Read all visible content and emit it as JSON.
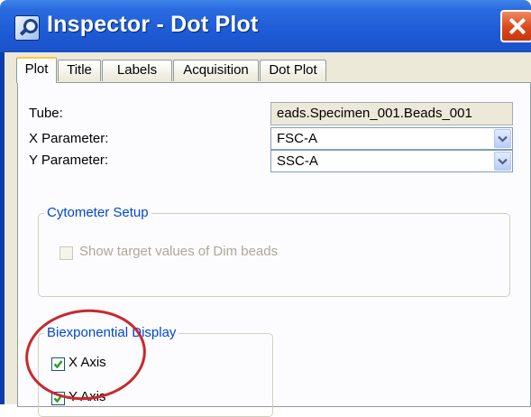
{
  "window": {
    "title": "Inspector - Dot Plot",
    "icon": "inspector-magnifier-icon",
    "close_icon": "close-icon"
  },
  "tabs": [
    {
      "label": "Plot",
      "active": true
    },
    {
      "label": "Title",
      "active": false
    },
    {
      "label": "Labels",
      "active": false
    },
    {
      "label": "Acquisition",
      "active": false
    },
    {
      "label": "Dot Plot",
      "active": false
    }
  ],
  "plot": {
    "tube_label": "Tube:",
    "tube_value": "eads.Specimen_001.Beads_001",
    "x_param_label": "X Parameter:",
    "x_param_value": "FSC-A",
    "y_param_label": "Y Parameter:",
    "y_param_value": "SSC-A"
  },
  "cytometer_setup": {
    "title": "Cytometer Setup",
    "show_target_label": "Show target values of Dim beads",
    "show_target_checked": false,
    "enabled": false
  },
  "biexponential": {
    "title": "Biexponential Display",
    "x_axis_label": "X Axis",
    "x_axis_checked": true,
    "y_axis_label": "Y Axis",
    "y_axis_checked": true
  },
  "annotation": {
    "highlight_color": "#c8282d"
  },
  "colors": {
    "titlebar": "#1e5bd6",
    "group_title": "#0046d5",
    "check": "#21a121",
    "active_tab_accent": "#ffc83d"
  }
}
